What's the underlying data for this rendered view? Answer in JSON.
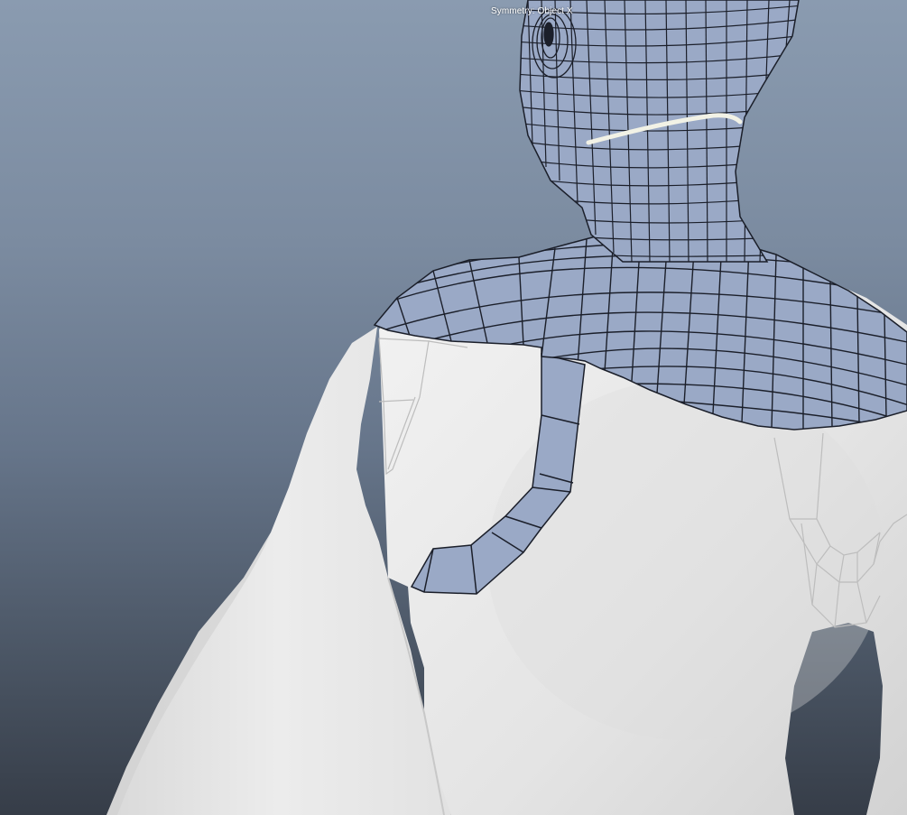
{
  "viewport": {
    "hud_text": "Symmetry: Object X"
  },
  "colors": {
    "background_top": "#8a9bb0",
    "background_bottom": "#363d48",
    "body_surface": "#e6e6e6",
    "retopo_mesh": "#9aa9c6",
    "wire": "#1b1f2a",
    "selected_edge": "#f2f2e6",
    "ghost_wire": "#b9b9b9"
  }
}
